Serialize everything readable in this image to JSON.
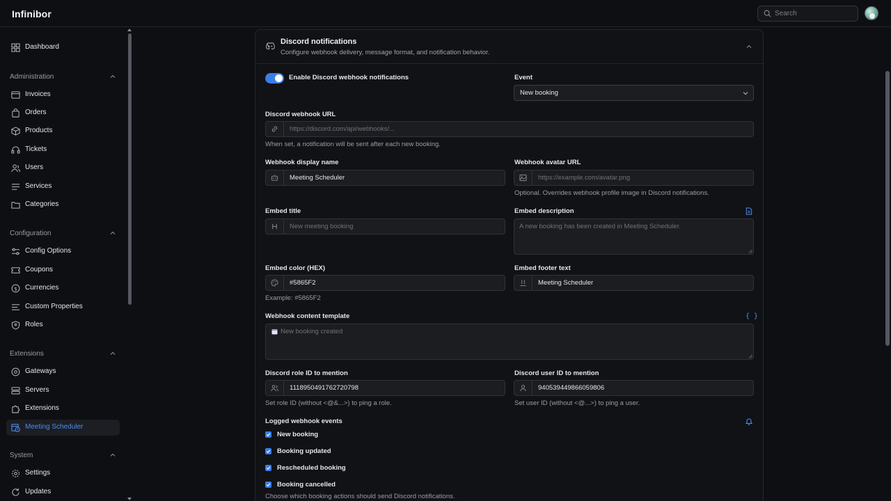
{
  "app": {
    "brand": "Infinibor",
    "search_placeholder": "Search"
  },
  "sidebar": {
    "dashboard": "Dashboard",
    "sections": {
      "administration": "Administration",
      "configuration": "Configuration",
      "extensions": "Extensions",
      "system": "System"
    },
    "admin_items": [
      "Invoices",
      "Orders",
      "Products",
      "Tickets",
      "Users",
      "Services",
      "Categories"
    ],
    "config_items": [
      "Config Options",
      "Coupons",
      "Currencies",
      "Custom Properties",
      "Roles"
    ],
    "ext_items": [
      "Gateways",
      "Servers",
      "Extensions",
      "Meeting Scheduler"
    ],
    "system_items": [
      "Settings",
      "Updates"
    ],
    "active": "Meeting Scheduler"
  },
  "card": {
    "title": "Discord notifications",
    "subtitle": "Configure webhook delivery, message format, and notification behavior.",
    "enable_label": "Enable Discord webhook notifications",
    "enabled": true,
    "event_label": "Event",
    "event_value": "New booking",
    "webhook_url_label": "Discord webhook URL",
    "webhook_url_placeholder": "https://discord.com/api/webhooks/...",
    "webhook_url_help": "When set, a notification will be sent after each new booking.",
    "display_name_label": "Webhook display name",
    "display_name_value": "Meeting Scheduler",
    "avatar_url_label": "Webhook avatar URL",
    "avatar_url_placeholder": "https://example.com/avatar.png",
    "avatar_url_help": "Optional. Overrides webhook profile image in Discord notifications.",
    "embed_title_label": "Embed title",
    "embed_title_placeholder": "New meeting booking",
    "embed_desc_label": "Embed description",
    "embed_desc_placeholder": "A new booking has been created in Meeting Scheduler.",
    "embed_color_label": "Embed color (HEX)",
    "embed_color_value": "#5865F2",
    "embed_color_help": "Example: #5865F2",
    "embed_footer_label": "Embed footer text",
    "embed_footer_value": "Meeting Scheduler",
    "content_template_label": "Webhook content template",
    "content_template_placeholder": "New booking created",
    "content_template_icon": "{ }",
    "role_id_label": "Discord role ID to mention",
    "role_id_value": "1118950491762720798",
    "role_id_help": "Set role ID (without <@&...>) to ping a role.",
    "user_id_label": "Discord user ID to mention",
    "user_id_value": "940539449866059806",
    "user_id_help": "Set user ID (without <@...>) to ping a user.",
    "logged_events_label": "Logged webhook events",
    "events": [
      "New booking",
      "Booking updated",
      "Rescheduled booking",
      "Booking cancelled"
    ],
    "events_help": "Choose which booking actions should send Discord notifications."
  },
  "colors": {
    "accent": "#3b7ee8",
    "active_text": "#4b8cf2",
    "background": "#0e0f12",
    "card": "#111215"
  }
}
